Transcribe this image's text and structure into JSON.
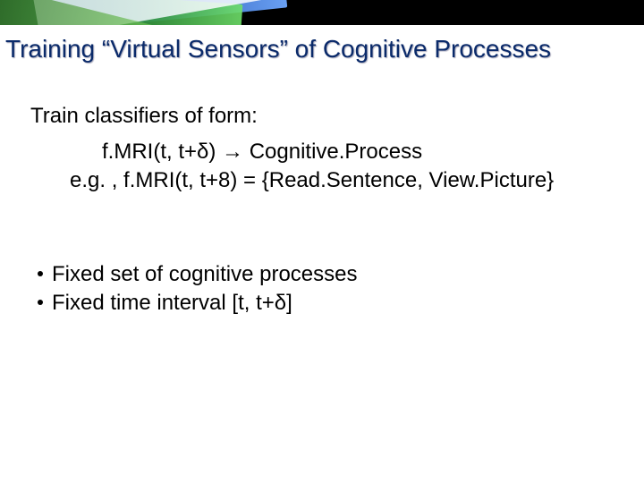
{
  "title": "Training “Virtual Sensors” of Cognitive Processes",
  "intro": "Train classifiers of form:",
  "formula": "f.MRI(t, t+δ) → Cognitive.Process",
  "example": "e.g. , f.MRI(t, t+8) = {Read.Sentence, View.Picture}",
  "bullets": [
    "Fixed set of cognitive processes",
    "Fixed time interval [t, t+δ]"
  ]
}
